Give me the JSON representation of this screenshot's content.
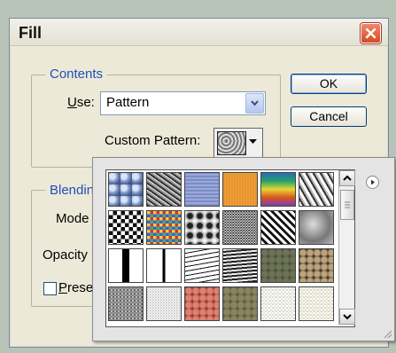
{
  "dialog": {
    "title": "Fill",
    "ok_label": "OK",
    "cancel_label": "Cancel",
    "contents_legend": "Contents",
    "use_label": "Use:",
    "use_label_accel": "U",
    "use_label_rest": "se:",
    "use_value": "Pattern",
    "custom_pattern_label": "Custom Pattern:",
    "blending_legend": "Blendin",
    "mode_label": "Mode",
    "opacity_label": "Opacity",
    "preserve_label": "Prese",
    "preserve_accel": "P",
    "preserve_rest": "rese"
  },
  "picker": {
    "patterns": [
      "bubbles",
      "wrinkles",
      "blue-fabric",
      "orange-burlap",
      "rainbow-stripes",
      "crumpled-paper",
      "checkerboard",
      "colored-chips",
      "marble-blobs",
      "static-noise",
      "woven-strands",
      "gray-clouds",
      "black-white-bars",
      "vertical-line",
      "horizontal-strokes",
      "wood-grain",
      "mossy-rock",
      "stone-pebbles",
      "granite",
      "white-speckle",
      "red-rock",
      "olive-rock",
      "pale-texture",
      "cream-texture"
    ]
  },
  "colors": {
    "legend_blue": "#1f4fb8",
    "dialog_bg": "#ece9d8",
    "close_red": "#d34a22"
  }
}
